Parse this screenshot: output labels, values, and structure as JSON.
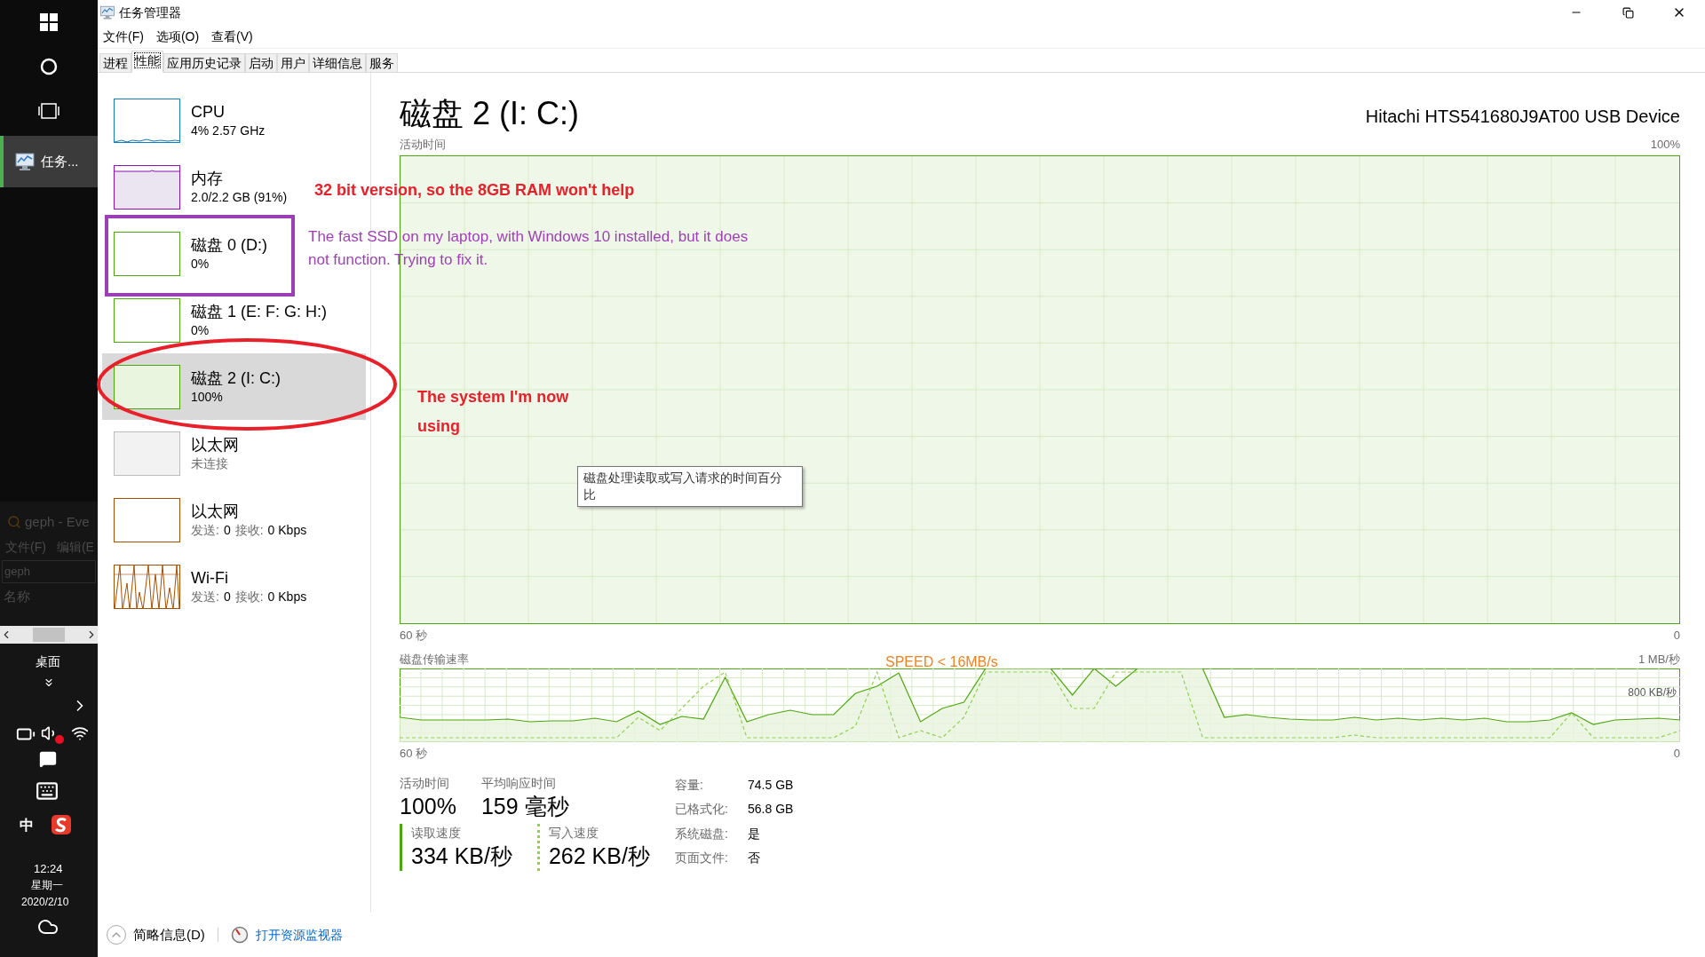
{
  "taskbar": {
    "pinned_app": "任务...",
    "desktop_label": "桌面",
    "ime": "中",
    "time": "12:24",
    "weekday": "星期一",
    "date": "2020/2/10"
  },
  "background_window": {
    "title": "geph - Eve",
    "menu": [
      "文件(F)",
      "编辑(E"
    ],
    "search": "geph",
    "column": "名称"
  },
  "window": {
    "title": "任务管理器"
  },
  "menu": [
    "文件(F)",
    "选项(O)",
    "查看(V)"
  ],
  "tabs": [
    {
      "label": "进程",
      "selected": false
    },
    {
      "label": "性能",
      "selected": true
    },
    {
      "label": "应用历史记录",
      "selected": false
    },
    {
      "label": "启动",
      "selected": false
    },
    {
      "label": "用户",
      "selected": false
    },
    {
      "label": "详细信息",
      "selected": false
    },
    {
      "label": "服务",
      "selected": false
    }
  ],
  "sidebar": [
    {
      "kind": "cpu",
      "name": "CPU",
      "detail": "4% 2.57 GHz",
      "color": "#117dbb",
      "selected": false
    },
    {
      "kind": "memory",
      "name": "内存",
      "detail": "2.0/2.2 GB (91%)",
      "color": "#8b12ae",
      "selected": false
    },
    {
      "kind": "disk",
      "name": "磁盘 0 (D:)",
      "detail": "0%",
      "color": "#4da60c",
      "selected": false
    },
    {
      "kind": "disk",
      "name": "磁盘 1 (E: F: G: H:)",
      "detail": "0%",
      "color": "#4da60c",
      "selected": false
    },
    {
      "kind": "disk",
      "name": "磁盘 2 (I: C:)",
      "detail": "100%",
      "color": "#4da60c",
      "level": 1,
      "selected": true
    },
    {
      "kind": "ethernet",
      "name": "以太网",
      "detail": "未连接",
      "color": "#bdbdbd",
      "connected": false,
      "selected": false
    },
    {
      "kind": "ethernet",
      "name": "以太网",
      "send_label": "发送:",
      "send": "0",
      "receive_label": "接收:",
      "receive": "0 Kbps",
      "color": "#a74f01",
      "connected": true,
      "selected": false
    },
    {
      "kind": "wifi",
      "name": "Wi-Fi",
      "send_label": "发送:",
      "send": "0",
      "receive_label": "接收:",
      "receive": "0 Kbps",
      "color": "#a74f01",
      "connected": true,
      "selected": false
    }
  ],
  "detail": {
    "title": "磁盘 2 (I: C:)",
    "device": "Hitachi HTS541680J9AT00 USB Device",
    "activity_chart": {
      "label": "活动时间",
      "max": "100%",
      "time_span": "60 秒",
      "min": "0"
    },
    "transfer_chart": {
      "label": "磁盘传输速率",
      "max": "1 MB/秒",
      "mid": "800 KB/秒",
      "time_span": "60 秒",
      "min": "0"
    },
    "stats": [
      {
        "label": "活动时间",
        "value": "100%"
      },
      {
        "label": "平均响应时间",
        "value": "159 毫秒"
      }
    ],
    "speeds": [
      {
        "kind": "read",
        "label": "读取速度",
        "value": "334 KB/秒"
      },
      {
        "kind": "write",
        "label": "写入速度",
        "value": "262 KB/秒"
      }
    ],
    "properties": [
      {
        "label": "容量:",
        "value": "74.5 GB"
      },
      {
        "label": "已格式化:",
        "value": "56.8 GB"
      },
      {
        "label": "系统磁盘:",
        "value": "是"
      },
      {
        "label": "页面文件:",
        "value": "否"
      }
    ]
  },
  "tooltip": "磁盘处理读取或写入请求的时间百分比",
  "footer": {
    "fewer_details": "简略信息(D)",
    "resource_monitor": "打开资源监视器"
  },
  "annotations": {
    "ram_note": "32 bit version, so the 8GB RAM won't help",
    "ssd_note": "The fast SSD on my laptop, with Windows 10 installed, but it does not function. Trying to fix it.",
    "system_note": [
      "The system I'm now",
      "using"
    ],
    "speed_note": "SPEED < 16MB/s"
  }
}
